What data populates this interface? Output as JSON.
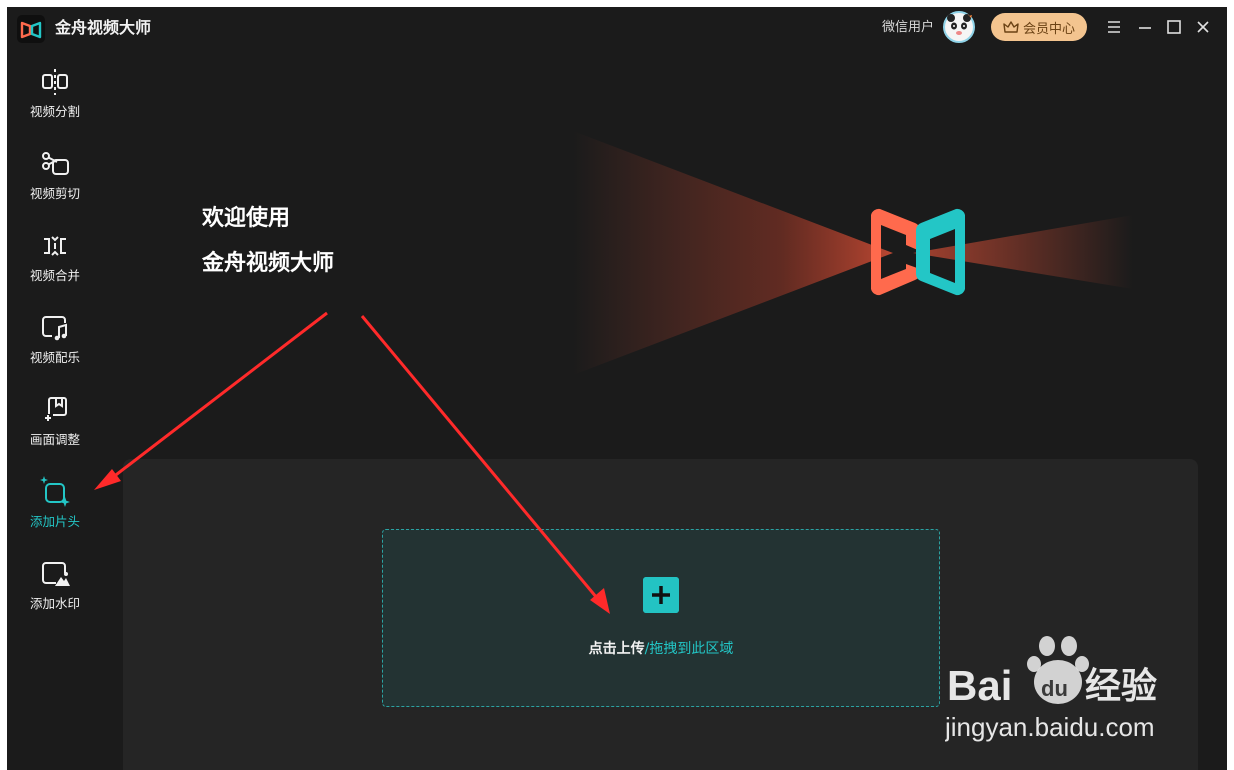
{
  "app": {
    "title": "金舟视频大师",
    "user": "微信用户",
    "vip_label": "会员中心"
  },
  "sidebar": {
    "items": [
      {
        "label": "视频分割",
        "icon": "split-icon"
      },
      {
        "label": "视频剪切",
        "icon": "scissors-icon"
      },
      {
        "label": "视频合并",
        "icon": "merge-icon"
      },
      {
        "label": "视频配乐",
        "icon": "music-icon"
      },
      {
        "label": "画面调整",
        "icon": "crop-icon"
      },
      {
        "label": "添加片头",
        "icon": "sparkle-screen-icon",
        "active": true
      },
      {
        "label": "添加水印",
        "icon": "watermark-icon"
      }
    ]
  },
  "main": {
    "welcome_line1": "欢迎使用",
    "welcome_line2": "金舟视频大师",
    "upload_click": "点击上传",
    "upload_drag": "/拖拽到此区域"
  },
  "watermark": {
    "brand": "Bai",
    "brand_du": "du",
    "brand_cn": "经验",
    "url": "jingyan.baidu.com"
  },
  "colors": {
    "accent": "#23c6c6",
    "logo_orange": "#ff6a4d",
    "vip_gold": "#f3c48f",
    "background": "#1b1b1b",
    "arrow_red": "#ff2a2a"
  }
}
